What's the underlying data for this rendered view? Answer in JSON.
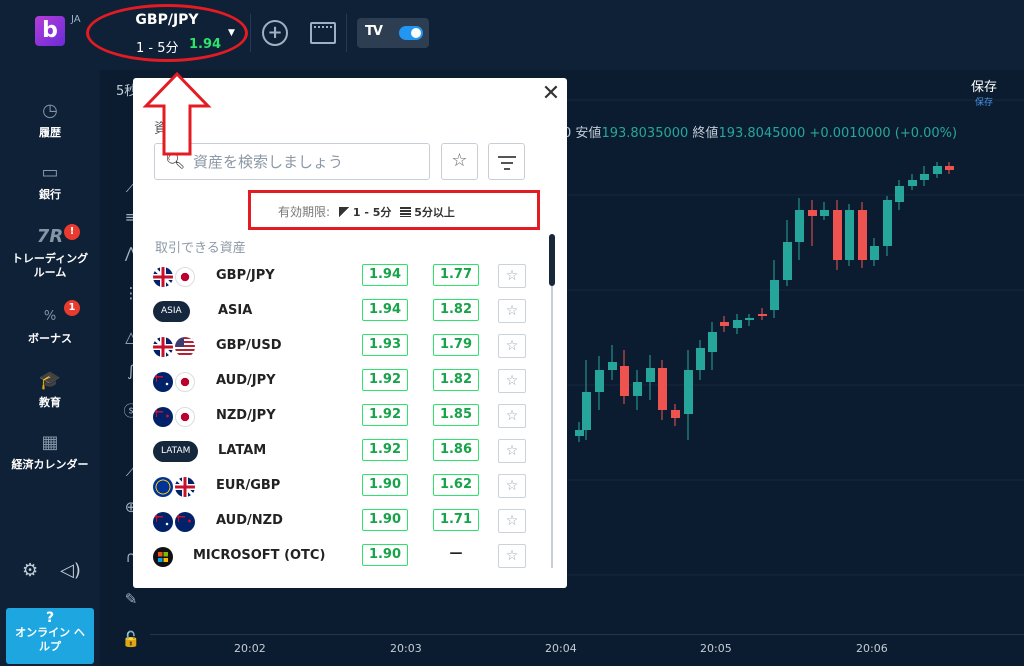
{
  "header": {
    "logo_letter": "b",
    "lang": "JA",
    "asset": {
      "name": "GBP/JPY",
      "expiry": "1 - 5分",
      "payout": "1.94"
    },
    "add_chart": "+",
    "tradingview_logo": "TV"
  },
  "sidebar": {
    "items": [
      {
        "label": "履歴",
        "icon": "history-icon",
        "glyph": "◷"
      },
      {
        "label": "銀行",
        "icon": "wallet-icon",
        "glyph": "▭"
      },
      {
        "label": "トレーディング\nルーム",
        "icon": "trading-room-icon",
        "glyph": "7R",
        "badge": "!"
      },
      {
        "label": "ボーナス",
        "icon": "bonus-icon",
        "glyph": "%",
        "badge": "1"
      },
      {
        "label": "教育",
        "icon": "education-icon",
        "glyph": "🎓"
      },
      {
        "label": "経済カレンダー",
        "icon": "calendar-icon",
        "glyph": "▦"
      }
    ],
    "help": {
      "q": "?",
      "label": "オンライン ヘルプ"
    }
  },
  "chart": {
    "timeframe": "5秒",
    "ohlc": {
      "low_label": "安値",
      "low": "193.8035000",
      "close_label": "終値",
      "close": "193.8045000",
      "change": "+0.0010000 (+0.00%)",
      "prefix": "0"
    },
    "save_label": "保存",
    "save_sub": "保存",
    "time_ticks": [
      "20:02",
      "20:03",
      "20:04",
      "20:05",
      "20:06"
    ],
    "colors": {
      "up": "#26a69a",
      "down": "#ef5350"
    }
  },
  "modal": {
    "title": "資産",
    "search_placeholder": "資産を検索しましょう",
    "expiry_label": "有効期限:",
    "expiry_short": "1 - 5分",
    "expiry_long": "5分以上",
    "section_label": "取引できる資産",
    "assets": [
      {
        "name": "GBP/JPY",
        "flags": [
          "gb",
          "jp"
        ],
        "p1": "1.94",
        "p2": "1.77"
      },
      {
        "name": "ASIA",
        "badge": "ASIA",
        "p1": "1.94",
        "p2": "1.82"
      },
      {
        "name": "GBP/USD",
        "flags": [
          "gb",
          "us"
        ],
        "p1": "1.93",
        "p2": "1.79"
      },
      {
        "name": "AUD/JPY",
        "flags": [
          "au",
          "jp"
        ],
        "p1": "1.92",
        "p2": "1.82"
      },
      {
        "name": "NZD/JPY",
        "flags": [
          "nz",
          "jp"
        ],
        "p1": "1.92",
        "p2": "1.85"
      },
      {
        "name": "LATAM",
        "badge": "LATAM",
        "p1": "1.92",
        "p2": "1.86"
      },
      {
        "name": "EUR/GBP",
        "flags": [
          "eu",
          "gb"
        ],
        "p1": "1.90",
        "p2": "1.62"
      },
      {
        "name": "AUD/NZD",
        "flags": [
          "au",
          "nz"
        ],
        "p1": "1.90",
        "p2": "1.71"
      },
      {
        "name": "MICROSOFT (OTC)",
        "flags": [
          "ms"
        ],
        "p1": "1.90",
        "p2": "—"
      }
    ]
  }
}
